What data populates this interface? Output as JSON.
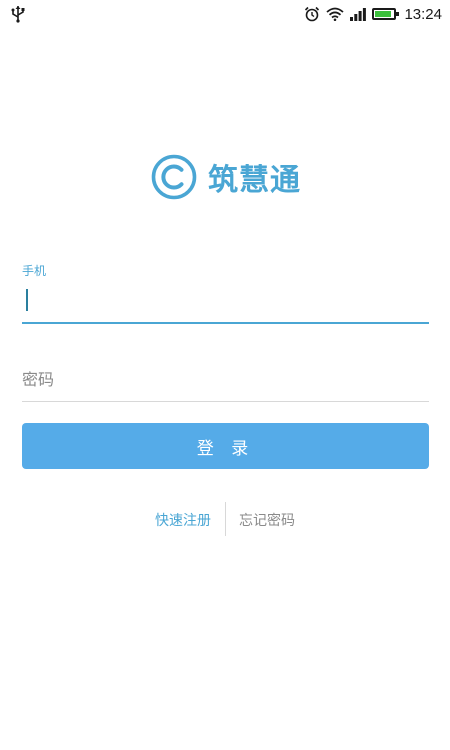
{
  "status_bar": {
    "time": "13:24",
    "battery_level": 0.9,
    "icons": [
      "usb-icon",
      "alarm-icon",
      "wifi-icon",
      "signal-icon",
      "battery-icon"
    ]
  },
  "logo": {
    "icon": "copyright-logo-icon",
    "text": "筑慧通"
  },
  "form": {
    "phone_label": "手机",
    "phone_value": "",
    "password_placeholder": "密码"
  },
  "login_button": {
    "label": "登 录"
  },
  "links": {
    "register": "快速注册",
    "forgot_password": "忘记密码"
  },
  "colors": {
    "accent": "#4aa6d4",
    "button": "#55abe8",
    "placeholder": "#8a8a8a",
    "divider": "#d8d8d8"
  }
}
